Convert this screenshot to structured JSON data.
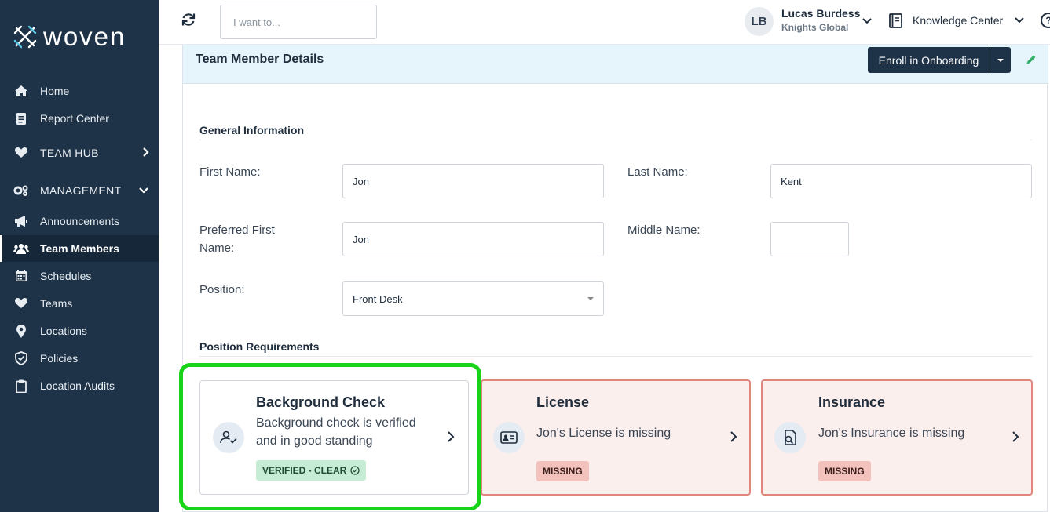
{
  "brand": {
    "name": "woven"
  },
  "sidebar": {
    "items": [
      {
        "label": "Home",
        "icon": "home-icon"
      },
      {
        "label": "Report Center",
        "icon": "report-icon"
      },
      {
        "label": "TEAM HUB",
        "icon": "heart-icon"
      },
      {
        "label": "MANAGEMENT",
        "icon": "gears-icon"
      },
      {
        "label": "Announcements",
        "icon": "megaphone-icon"
      },
      {
        "label": "Team Members",
        "icon": "users-icon",
        "active": true
      },
      {
        "label": "Schedules",
        "icon": "calendar-icon"
      },
      {
        "label": "Teams",
        "icon": "heart-icon"
      },
      {
        "label": "Locations",
        "icon": "map-pin-icon"
      },
      {
        "label": "Policies",
        "icon": "shield-icon"
      },
      {
        "label": "Location Audits",
        "icon": "clipboard-icon"
      }
    ]
  },
  "topbar": {
    "search_placeholder": "I want to...",
    "user": {
      "initials": "LB",
      "name": "Lucas Burdess",
      "org": "Knights Global"
    },
    "knowledge_center": "Knowledge Center",
    "help": "?"
  },
  "panel": {
    "title": "Team Member Details",
    "enroll_label": "Enroll in Onboarding"
  },
  "general": {
    "title": "General Information",
    "first_name_label": "First Name:",
    "first_name_value": "Jon",
    "last_name_label": "Last Name:",
    "last_name_value": "Kent",
    "preferred_label_line1": "Preferred First",
    "preferred_label_line2": "Name:",
    "preferred_value": "Jon",
    "middle_label": "Middle Name:",
    "middle_value": "",
    "position_label": "Position:",
    "position_value": "Front Desk"
  },
  "requirements": {
    "title": "Position Requirements",
    "cards": [
      {
        "title": "Background Check",
        "desc_line1": "Background check is verified",
        "desc_line2": "and in good standing",
        "badge": "VERIFIED - CLEAR",
        "status": "ok",
        "icon": "user-check-icon"
      },
      {
        "title": "License",
        "desc_line1": "Jon's License is missing",
        "badge": "MISSING",
        "status": "missing",
        "icon": "id-card-icon"
      },
      {
        "title": "Insurance",
        "desc_line1": "Jon's Insurance is missing",
        "badge": "MISSING",
        "status": "missing",
        "icon": "insurance-icon"
      }
    ]
  },
  "colors": {
    "sidebar_bg": "#1e3348",
    "header_bg": "#e6f4fb",
    "highlight": "#18d418",
    "missing_border": "#e2857c",
    "verified_badge": "#c6ecd6"
  }
}
